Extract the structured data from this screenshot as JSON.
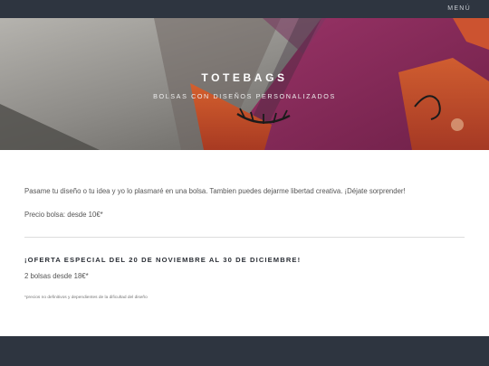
{
  "nav": {
    "menu_label": "MENÚ"
  },
  "hero": {
    "title": "TOTEBAGS",
    "subtitle": "BOLSAS CON DISEÑOS PERSONALIZADOS"
  },
  "content": {
    "intro": "Pasame tu diseño o tu idea y yo lo plasmaré en una bolsa. Tambien puedes dejarme libertad creativa. ¡Déjate sorprender!",
    "price": "Precio bolsa: desde 10€*",
    "offer_heading": "¡OFERTA ESPECIAL DEL 20 DE NOVIEMBRE AL 30 DE DICIEMBRE!",
    "offer_text": "2 bolsas desde 18€*",
    "footnote": "*precios no definitivos y dependientes de la dificultad del diseño"
  },
  "colors": {
    "topbar": "#2e3540",
    "footer": "#2e3540",
    "hero_magenta": "#8a2c5e",
    "hero_orange": "#c8502e",
    "hero_gray": "#8a8884"
  }
}
